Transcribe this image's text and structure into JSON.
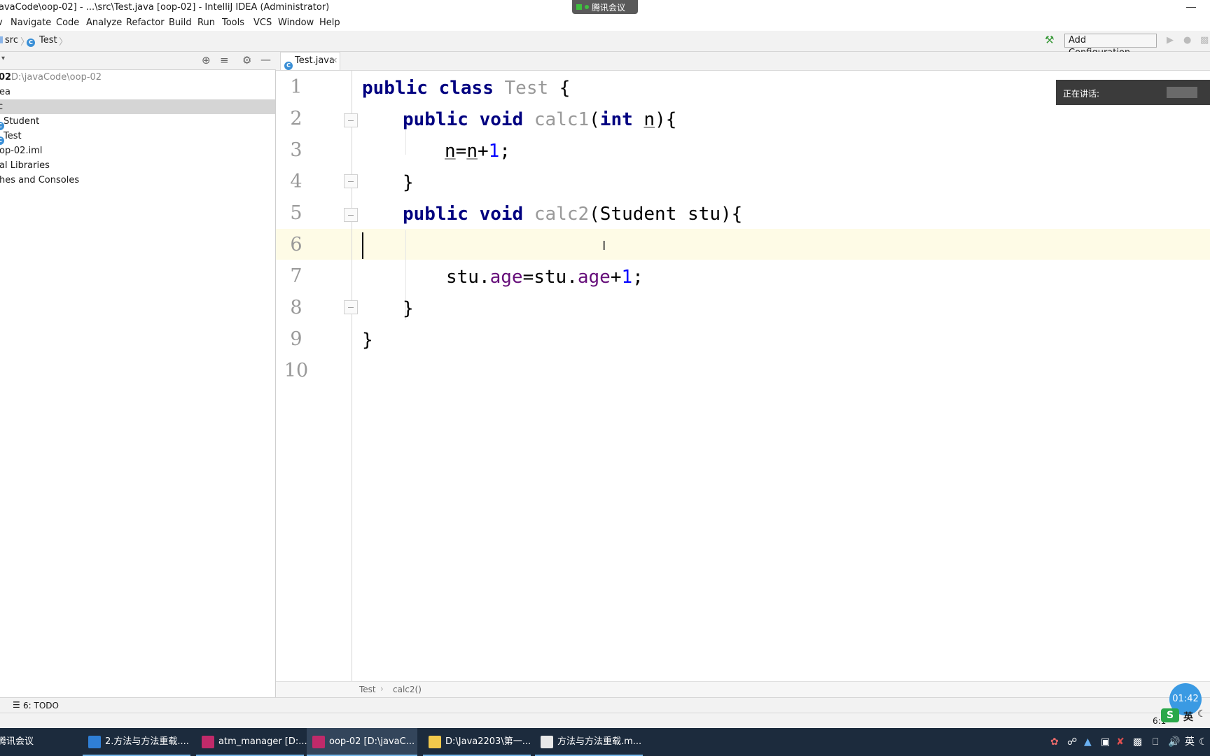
{
  "window": {
    "title": "avaCode\\oop-02] - ...\\src\\Test.java [oop-02] - IntelliJ IDEA (Administrator)",
    "meeting_label": "腾讯会议"
  },
  "menu": [
    "Navigate",
    "Code",
    "Analyze",
    "Refactor",
    "Build",
    "Run",
    "Tools",
    "VCS",
    "Window",
    "Help"
  ],
  "nav": {
    "crumbs": [
      "src",
      "Test"
    ],
    "add_config_label": "Add Configuration..."
  },
  "project_tree": [
    {
      "label": "02",
      "extra": "D:\\javaCode\\oop-02"
    },
    {
      "label": "ea"
    },
    {
      "label": "c"
    },
    {
      "label": "Student"
    },
    {
      "label": "Test"
    },
    {
      "label": "op-02.iml"
    },
    {
      "label": "al Libraries"
    },
    {
      "label": "hes and Consoles"
    }
  ],
  "editor": {
    "tab_label": "Test.java",
    "line_numbers": [
      "1",
      "2",
      "3",
      "4",
      "5",
      "6",
      "7",
      "8",
      "9",
      "10"
    ],
    "speaking_label": "正在讲话:",
    "breadcrumb": [
      "Test",
      "calc2()"
    ]
  },
  "code": {
    "l1": {
      "kw1": "public",
      "kw2": "class",
      "name": "Test",
      "brace": "{"
    },
    "l2": {
      "kw1": "public",
      "kw2": "void",
      "name": "calc1",
      "paren": "(",
      "kw3": "int",
      "param": "n",
      "close": "){"
    },
    "l3": {
      "a": "n",
      "eq": "=",
      "b": "n",
      "plus": "+",
      "num": "1",
      "semi": ";"
    },
    "l4": {
      "brace": "}"
    },
    "l5": {
      "kw1": "public",
      "kw2": "void",
      "name": "calc2",
      "rest": "(Student stu){"
    },
    "l7": {
      "a": "stu.",
      "f1": "age",
      "eq": "=stu.",
      "f2": "age",
      "plus": "+",
      "num": "1",
      "semi": ";"
    },
    "l8": {
      "brace": "}"
    },
    "l9": {
      "brace": "}"
    }
  },
  "tool_strip": {
    "todo_label": "6: TODO"
  },
  "status": {
    "position": "6:1"
  },
  "timer": "01:42",
  "ime": "英",
  "taskbar": {
    "items": [
      {
        "label": "腾讯会议"
      },
      {
        "label": "2.方法与方法重载...."
      },
      {
        "label": "atm_manager [D:..."
      },
      {
        "label": "oop-02 [D:\\javaC..."
      },
      {
        "label": "D:\\Java2203\\第一..."
      },
      {
        "label": "方法与方法重载.m..."
      }
    ],
    "tray_lang": "英"
  }
}
